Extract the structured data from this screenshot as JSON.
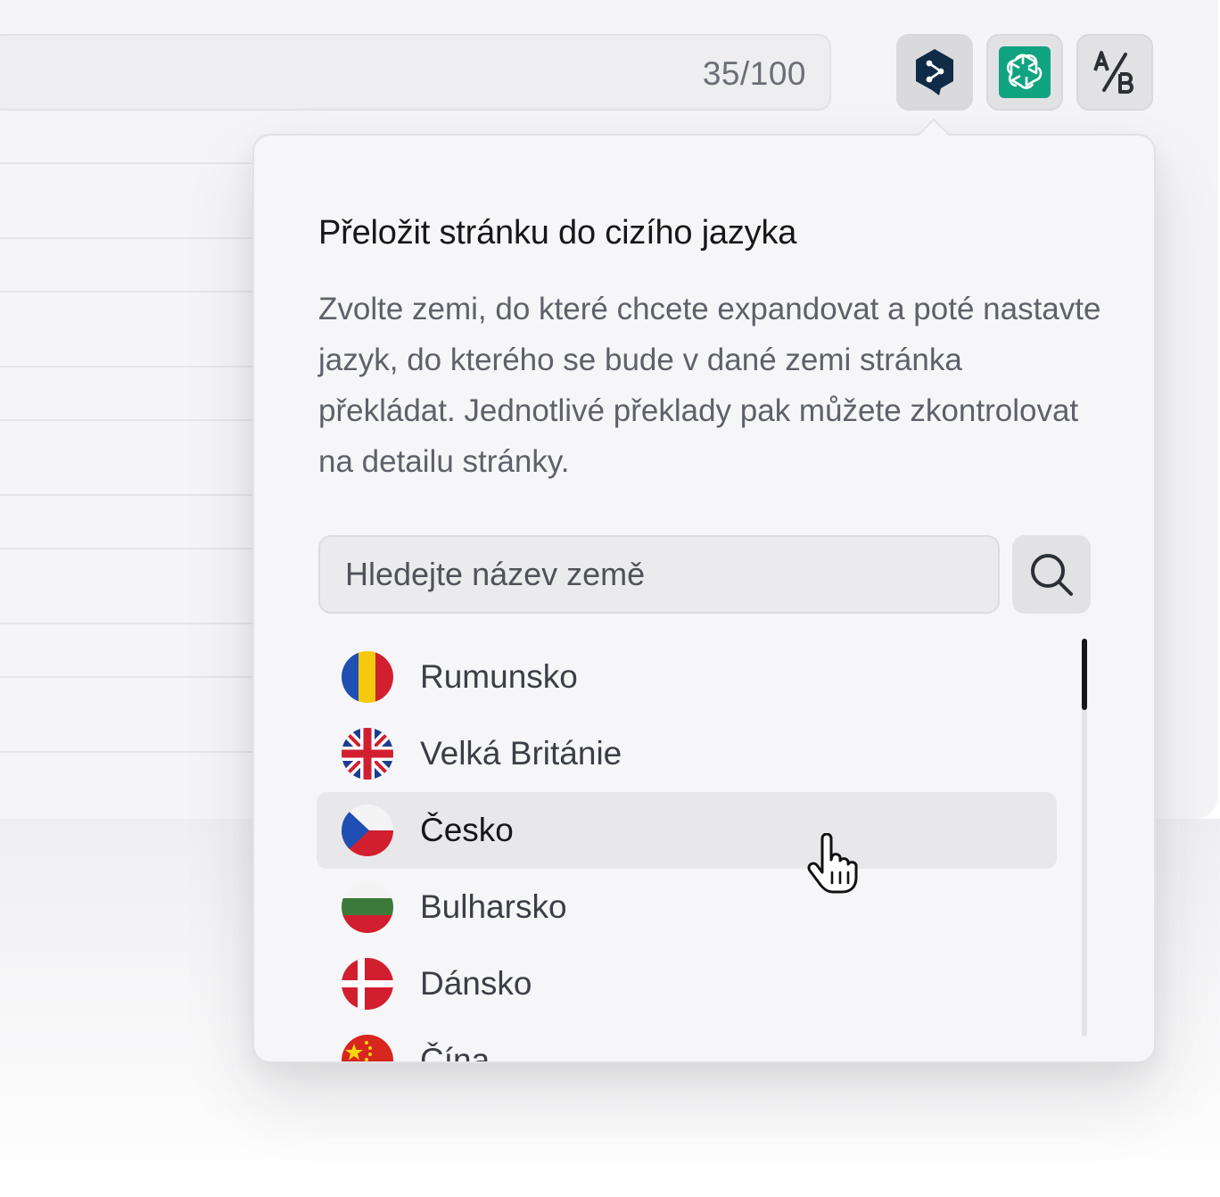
{
  "header": {
    "counter": "35/100"
  },
  "toolbar": {
    "buttons": [
      {
        "name": "translate-tool",
        "icon": "deepl-logo-icon",
        "color": "#0f2b46",
        "active": true
      },
      {
        "name": "ai-tool",
        "icon": "openai-logo-icon",
        "color": "#10a37f",
        "active": false
      },
      {
        "name": "ab-test-tool",
        "icon": "ab-test-icon",
        "color": "#2c2f36",
        "active": false
      }
    ]
  },
  "popover": {
    "title": "Přeložit stránku do  cizího jazyka",
    "description": "Zvolte zemi, do které chcete expandovat a poté nastavte jazyk, do kterého se bude v dané zemi stránka překládat. Jednotlivé překlady pak můžete zkontrolovat na detailu stránky.",
    "search": {
      "placeholder": "Hledejte název země",
      "value": ""
    },
    "countries": [
      {
        "label": "Rumunsko",
        "flag": "romania-flag-icon",
        "hovered": false
      },
      {
        "label": "Velká Británie",
        "flag": "uk-flag-icon",
        "hovered": false
      },
      {
        "label": "Česko",
        "flag": "czech-flag-icon",
        "hovered": true
      },
      {
        "label": "Bulharsko",
        "flag": "bulgaria-flag-icon",
        "hovered": false
      },
      {
        "label": "Dánsko",
        "flag": "denmark-flag-icon",
        "hovered": false
      },
      {
        "label": "Čína",
        "flag": "china-flag-icon",
        "hovered": false
      }
    ]
  }
}
